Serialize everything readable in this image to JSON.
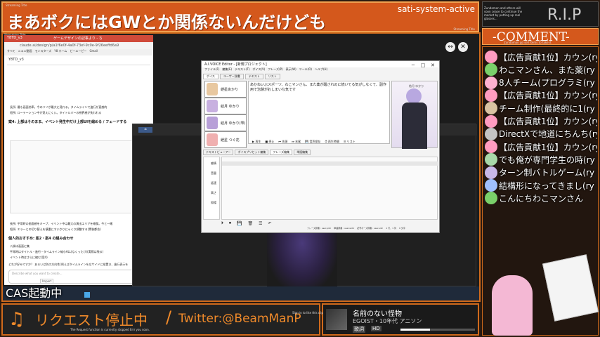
{
  "stream": {
    "title": "まあボクにはGWとか関係ないんだけども",
    "title_small": "Streaming Title",
    "system_label": "sati-system-active",
    "rip_label": "R.I.P",
    "rip_text": "Zundamon and others will soon cease to continue the market by putting up real glasses...",
    "comment_header": "-COMMENT-",
    "comment_sub": "Zundamon go sell items to take it",
    "cas_label": "CAS起動中",
    "request_label": "リクエスト停止中",
    "request_sub": "The Request function is currently stopped Errr you soon.",
    "twitter": "Twitter:@BeamManP",
    "music_title": "名前のない怪物",
    "music_artist": "EGOIST・10年代 アニソン",
    "music_tag1": "歌詞",
    "music_tag2": "HD",
    "music_small": "Sign in to like this clip",
    "left_small": "Streaming Title",
    "right_small": "Streaming Title"
  },
  "comments": [
    {
      "text": "【広告貢献1位】カウン(ry",
      "color": "#ff9cc0"
    },
    {
      "text": "わこマンさん、また薬(ry",
      "color": "#7ad06a"
    },
    {
      "text": "8人チーム(プログラミ(ry",
      "color": "#ffb2d0"
    },
    {
      "text": "【広告貢献1位】カウン(ry",
      "color": "#ff9cc0"
    },
    {
      "text": "チーム制作(最終的に1(ry",
      "color": "#d9c3a2"
    },
    {
      "text": "【広告貢献1位】カウン(ry",
      "color": "#ff9cc0"
    },
    {
      "text": "DirectXで地道にちんち(ry",
      "color": "#c4c4c4"
    },
    {
      "text": "【広告貢献1位】カウン(ry",
      "color": "#ff9cc0"
    },
    {
      "text": "でも俺が専門学生の時(ry",
      "color": "#a8d8a8"
    },
    {
      "text": "ターン制バトルゲーム(ry",
      "color": "#c8b8e8"
    },
    {
      "text": "結構形になってきまし(ry",
      "color": "#a0c0ff"
    },
    {
      "text": "こんにちわこマンさん",
      "color": "#7ad06a"
    }
  ],
  "browser": {
    "tab1": "Y8TD_v3",
    "tab2": "ゲームデザインの記事より - ちり...",
    "url": "claude.ai/design/p/a1f6e0f-4a0f-73ef-9c0e-9f26eeffd6a9",
    "bookmarks": [
      "すべて",
      "ニコニ動画",
      "モンスターズ",
      "Y8 ホーム",
      "ビーエーピー",
      "Gmail"
    ],
    "doc_title": "Y8TD_v3",
    "section_head": "案4: 上部はそのまま、イベント発生中だけ上部UIを縮める / フェードする",
    "section_head2": "個人的おすすめ: 案2・案4 の組み合わせ",
    "bullets": [
      "長所: 最も画面効率。今のリソが最大に見れる。タイムラインで進行が直感的",
      "短所: ローテーション中が見えにくい。タイトルバーの視界感が失われる",
      "長所: 平常時の画面感をキープ、イベント中は最大の演出エリアを確保。今と一緒",
      "短所: エラーとの切り替えを慎重にすいかりにゃくり調整する(実装都合)"
    ],
    "bullets2": [
      "八掛は画面に集",
      "平常時はタイトル・進行・タイムライン縮小ALL(なくったけ)(実際は残る)",
      "イベント時はさらに縮む(案4)"
    ],
    "footer_text": "どれが好みですか？ あるいは別の方向性(例えばタイムラインを左サイドに縦置き、進行表示を",
    "input_placeholder": "Describe what you want to create...",
    "import_label": "Import"
  },
  "voice_app": {
    "title": "A.I.VOICE Editor - [新規プロジェクト]",
    "menu": [
      "ファイル(F)",
      "編集(E)",
      "テキスト(T)",
      "ボイス(V)",
      "フレーズ(P)",
      "表示(W)",
      "ツール(O)",
      "ヘルプ(H)"
    ],
    "tabs_top": [
      "ボイス",
      "ユーザー辞書",
      "テキスト",
      "リスト"
    ],
    "voices": [
      "紲星あかり",
      "結月 ゆかり",
      "結月 ゆかり(雫)",
      "紲星 つぐ花"
    ],
    "textbox": "あかねいぶスポーツ、わこマンさん、また薬が醒されのに続いてる気がしなくて、副作用で治験がおしまいな気です",
    "speaker_label": "結月 ゆかり",
    "controls": [
      "再生",
      "停止",
      "先頭",
      "末尾",
      "音声保存",
      "再生時間",
      "リスト"
    ],
    "bottom_tabs": [
      "テキストビューアー",
      "ボイスプリセット編集",
      "フレーズ編集",
      "単語編集"
    ],
    "params": [
      "感情",
      "音量",
      "話速",
      "高さ",
      "抑揚"
    ],
    "status": [
      "フレーズ辞書 : user.pdic",
      "単語辞書 : user.wdic",
      "記号ポーズ辞書 : user.sdic",
      "1 行、1 列",
      "0 文字"
    ]
  }
}
